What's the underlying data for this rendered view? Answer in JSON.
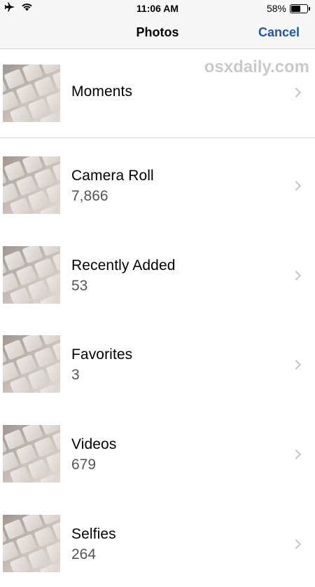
{
  "status_bar": {
    "time": "11:06 AM",
    "battery_percent_label": "58%",
    "battery_level": 0.58,
    "icons": [
      "airplane-icon",
      "wifi-icon",
      "battery-icon"
    ]
  },
  "nav": {
    "title": "Photos",
    "cancel_label": "Cancel"
  },
  "watermark": "osxdaily.com",
  "albums": [
    {
      "name": "Moments",
      "count": ""
    },
    {
      "name": "Camera Roll",
      "count": "7,866"
    },
    {
      "name": "Recently Added",
      "count": "53"
    },
    {
      "name": "Favorites",
      "count": "3"
    },
    {
      "name": "Videos",
      "count": "679"
    },
    {
      "name": "Selfies",
      "count": "264"
    }
  ],
  "colors": {
    "accent": "#1e56b4",
    "bar_background": "#f7f7f7",
    "chevron": "#c4c4c4",
    "count_text": "#555555"
  }
}
